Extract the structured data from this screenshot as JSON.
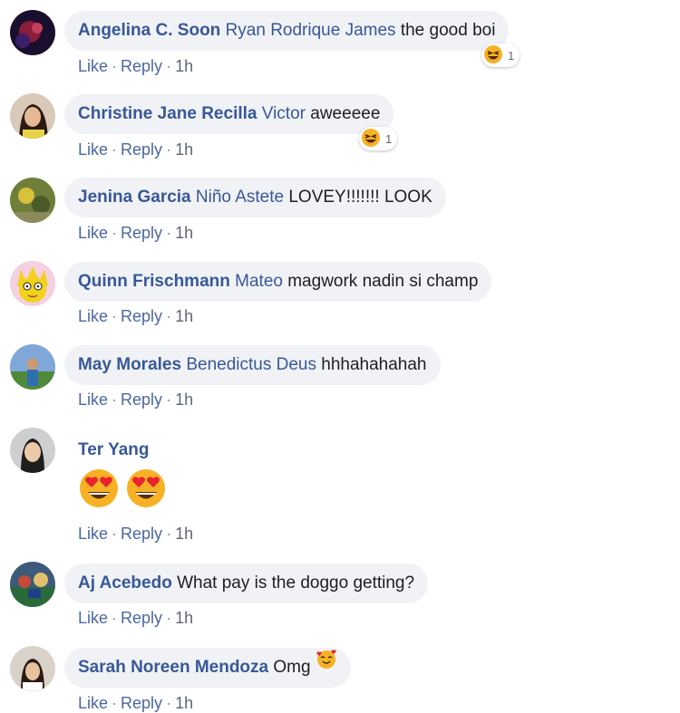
{
  "action_labels": {
    "like": "Like",
    "reply": "Reply",
    "separator": "·"
  },
  "comments": [
    {
      "author": "Angelina C. Soon",
      "tag": "Ryan Rodrique James",
      "text": "the good boi",
      "time": "1h",
      "reaction": {
        "icon": "laughing-emoji",
        "count": "1"
      }
    },
    {
      "author": "Christine Jane Recilla",
      "tag": "Victor",
      "text": "aweeeee",
      "time": "1h",
      "reaction": {
        "icon": "laughing-emoji",
        "count": "1"
      }
    },
    {
      "author": "Jenina Garcia",
      "tag": "Niño Astete",
      "text": "LOVEY!!!!!!! LOOK",
      "time": "1h"
    },
    {
      "author": "Quinn Frischmann",
      "tag": "Mateo",
      "text": "magwork nadin si champ",
      "time": "1h"
    },
    {
      "author": "May Morales",
      "tag": "Benedictus Deus",
      "text": "hhhahahahah",
      "time": "1h"
    },
    {
      "author": "Ter Yang",
      "tag": "",
      "text": "",
      "time": "1h",
      "emoji_icons": [
        "heart-eyes-emoji",
        "heart-eyes-emoji"
      ]
    },
    {
      "author": "Aj Acebedo",
      "tag": "",
      "text": "What pay is the doggo getting?",
      "time": "1h"
    },
    {
      "author": "Sarah Noreen Mendoza",
      "tag": "",
      "text": "Omg",
      "time": "1h",
      "inline_emoji": "smiling-face-with-hearts-emoji"
    }
  ]
}
